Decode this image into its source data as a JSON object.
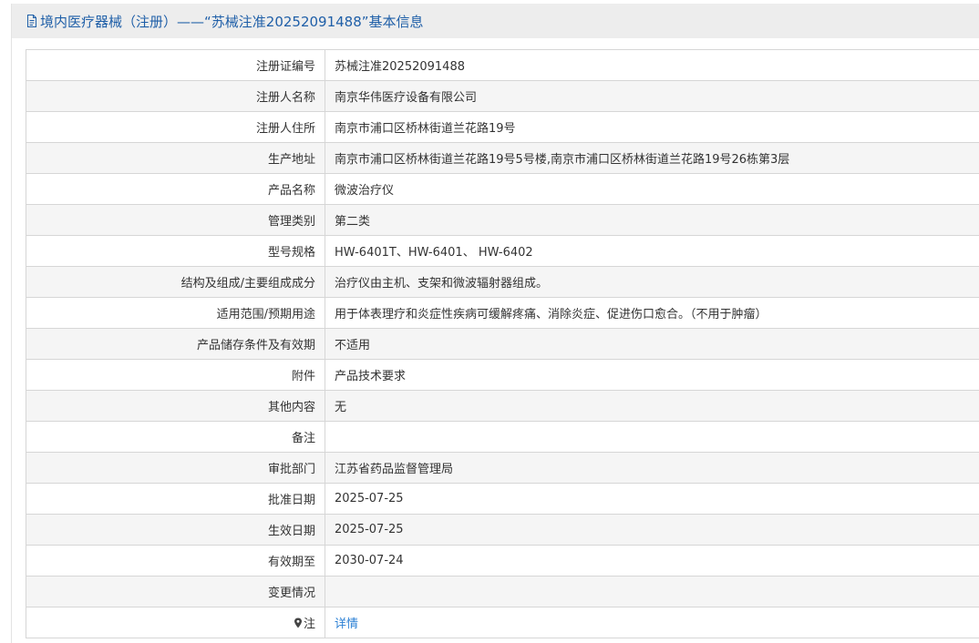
{
  "header": {
    "title": "境内医疗器械（注册）——“苏械注准20252091488”基本信息"
  },
  "rows": [
    {
      "label": "注册证编号",
      "value": "苏械注准20252091488"
    },
    {
      "label": "注册人名称",
      "value": "南京华伟医疗设备有限公司"
    },
    {
      "label": "注册人住所",
      "value": "南京市浦口区桥林街道兰花路19号"
    },
    {
      "label": "生产地址",
      "value": "南京市浦口区桥林街道兰花路19号5号楼,南京市浦口区桥林街道兰花路19号26栋第3层"
    },
    {
      "label": "产品名称",
      "value": "微波治疗仪"
    },
    {
      "label": "管理类别",
      "value": "第二类"
    },
    {
      "label": "型号规格",
      "value": "HW-6401T、HW-6401、 HW-6402"
    },
    {
      "label": "结构及组成/主要组成成分",
      "value": "治疗仪由主机、支架和微波辐射器组成。"
    },
    {
      "label": "适用范围/预期用途",
      "value": "用于体表理疗和炎症性疾病可缓解疼痛、消除炎症、促进伤口愈合。（不用于肿瘤）"
    },
    {
      "label": "产品储存条件及有效期",
      "value": "不适用"
    },
    {
      "label": "附件",
      "value": "产品技术要求"
    },
    {
      "label": "其他内容",
      "value": "无"
    },
    {
      "label": "备注",
      "value": ""
    },
    {
      "label": "审批部门",
      "value": "江苏省药品监督管理局"
    },
    {
      "label": "批准日期",
      "value": "2025-07-25"
    },
    {
      "label": "生效日期",
      "value": "2025-07-25"
    },
    {
      "label": "有效期至",
      "value": "2030-07-24"
    },
    {
      "label": "变更情况",
      "value": ""
    }
  ],
  "note_row": {
    "label": "注",
    "link_text": "详情",
    "icon": "pin-icon"
  },
  "colors": {
    "header_bg": "#ededed",
    "header_text": "#1f5fa8",
    "row_alt_bg": "#f5f5f5",
    "border": "#d6d6d6",
    "link": "#2a7fd4"
  }
}
